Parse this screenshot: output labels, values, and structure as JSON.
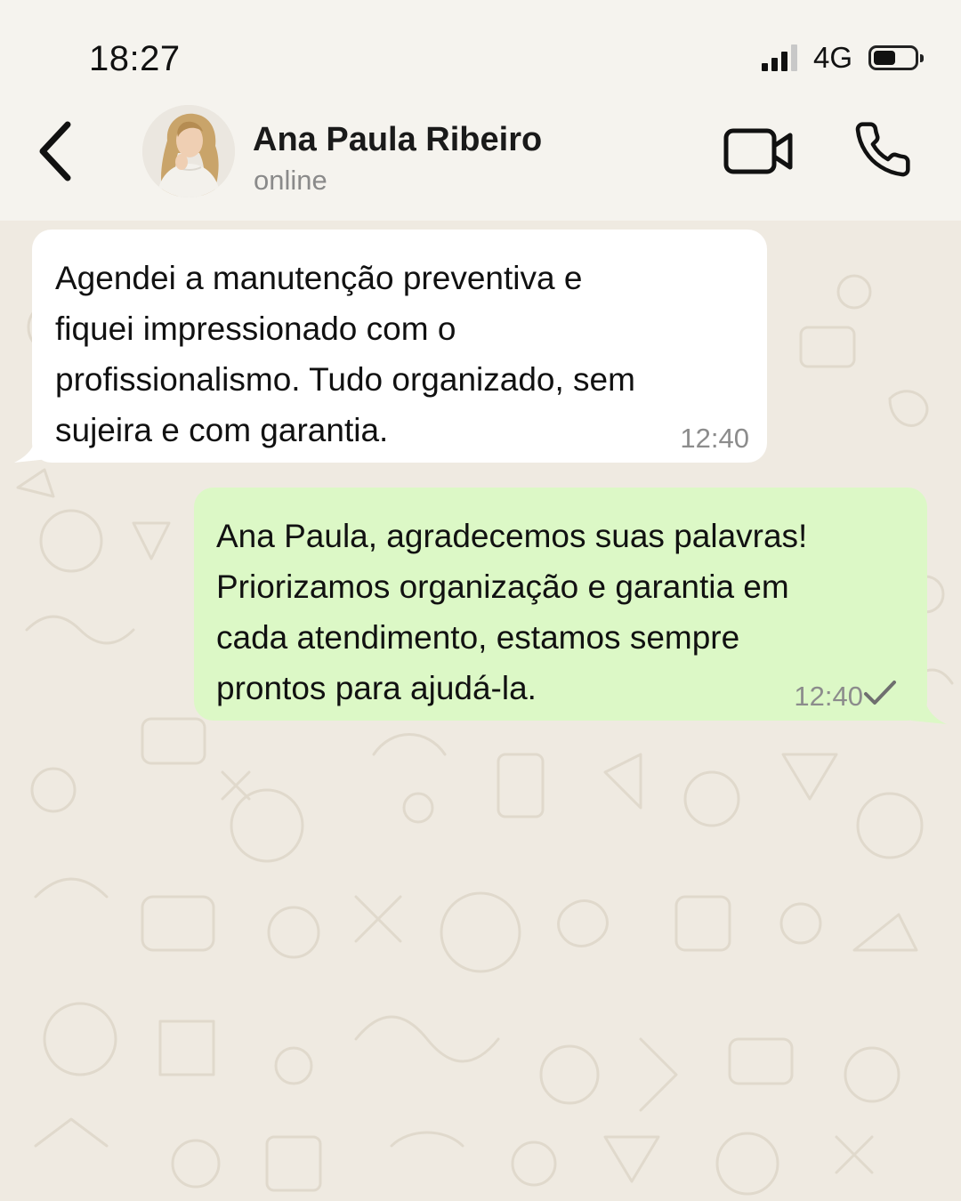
{
  "status_bar": {
    "time": "18:27",
    "network": "4G",
    "icons": [
      "signal-bars-icon",
      "battery-icon"
    ]
  },
  "header": {
    "contact_name": "Ana Paula Ribeiro",
    "contact_status": "online",
    "icons": [
      "chevron-left-icon",
      "avatar-photo",
      "video-camera-icon",
      "phone-icon"
    ]
  },
  "messages": [
    {
      "direction": "incoming",
      "lines": [
        "Agendei a manutenção preventiva e",
        "fiquei impressionado com o",
        "profissionalismo. Tudo organizado, sem",
        "sujeira e com garantia."
      ],
      "time": "12:40"
    },
    {
      "direction": "outgoing",
      "lines": [
        "Ana Paula, agradecemos suas palavras!",
        "Priorizamos organização e garantia em",
        "cada atendimento, estamos sempre",
        "prontos para ajudá-la."
      ],
      "time": "12:40",
      "status_icon": "single-check-icon"
    }
  ],
  "colors": {
    "header_bg": "#f5f3ee",
    "chat_bg": "#efeae1",
    "incoming_bubble": "#ffffff",
    "outgoing_bubble": "#dcf8c6",
    "muted_text": "#8a8a8a"
  }
}
